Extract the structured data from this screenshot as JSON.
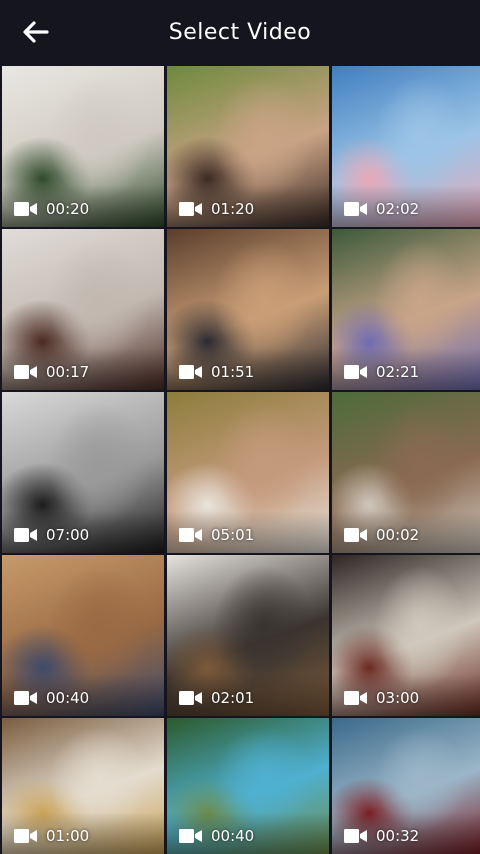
{
  "header": {
    "title": "Select Video",
    "back_icon": "back-arrow-icon"
  },
  "videos": [
    {
      "duration": "00:20",
      "colors": [
        "#e9e7e2",
        "#cfcac1",
        "#2e4a2a"
      ]
    },
    {
      "duration": "01:20",
      "colors": [
        "#6e8a3c",
        "#c9a385",
        "#3b2a24"
      ]
    },
    {
      "duration": "02:02",
      "colors": [
        "#3f7fc0",
        "#9cc4e6",
        "#e8a9b8"
      ]
    },
    {
      "duration": "00:17",
      "colors": [
        "#e0dcd8",
        "#c2b8b0",
        "#4a2a22"
      ]
    },
    {
      "duration": "01:51",
      "colors": [
        "#5a3e2c",
        "#c99e76",
        "#2c2a30"
      ]
    },
    {
      "duration": "02:21",
      "colors": [
        "#3c5a3a",
        "#c8a488",
        "#6f6cb0"
      ]
    },
    {
      "duration": "07:00",
      "colors": [
        "#d9d9d9",
        "#9a9a9a",
        "#1c1c1c"
      ]
    },
    {
      "duration": "05:01",
      "colors": [
        "#8c7d3a",
        "#c49a7c",
        "#e8e4dc"
      ]
    },
    {
      "duration": "00:02",
      "colors": [
        "#4d6b3a",
        "#8a6a52",
        "#cfc7bc"
      ]
    },
    {
      "duration": "00:40",
      "colors": [
        "#c79a6a",
        "#9a6a44",
        "#3e4a6a"
      ]
    },
    {
      "duration": "02:01",
      "colors": [
        "#e6e3de",
        "#3a3430",
        "#7c5a3a"
      ]
    },
    {
      "duration": "03:00",
      "colors": [
        "#2e2624",
        "#cfc8bc",
        "#6a2a22"
      ]
    },
    {
      "duration": "01:00",
      "colors": [
        "#7a5c3e",
        "#e4dccf",
        "#c9a257"
      ]
    },
    {
      "duration": "00:40",
      "colors": [
        "#2c5a2c",
        "#4fb0d0",
        "#6c8c4c"
      ]
    },
    {
      "duration": "00:32",
      "colors": [
        "#3a6a8a",
        "#9cb6c8",
        "#7a1f24"
      ]
    }
  ]
}
